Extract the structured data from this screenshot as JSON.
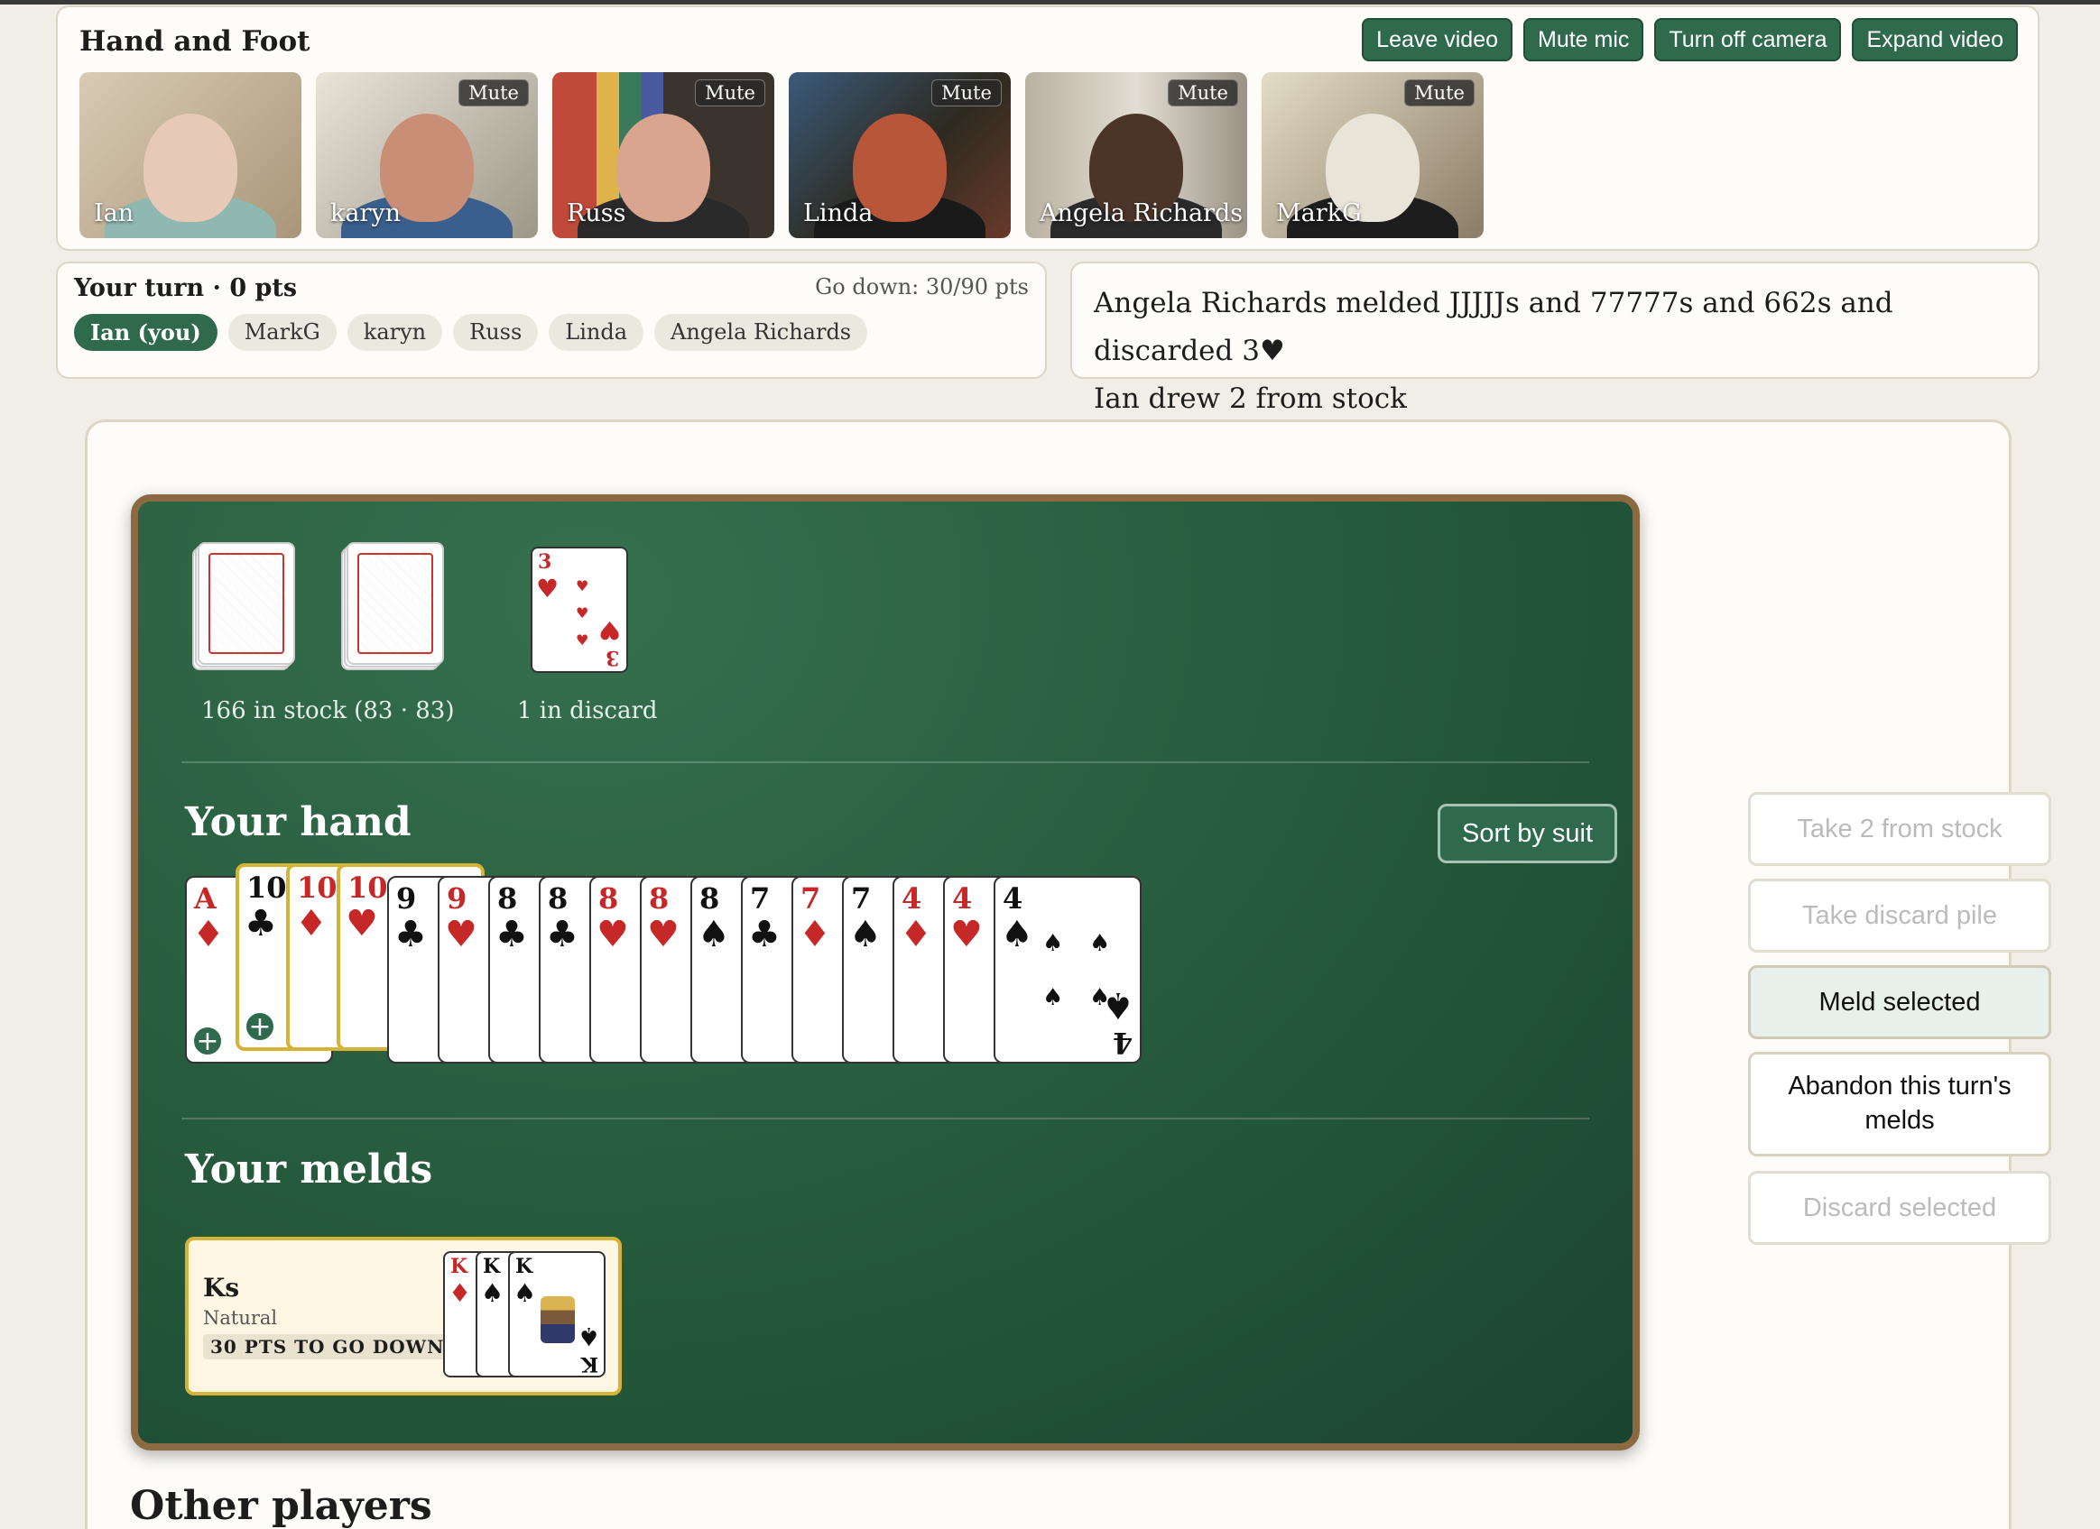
{
  "app": {
    "title": "Hand and Foot"
  },
  "video_controls": {
    "leave": "Leave video",
    "mute": "Mute mic",
    "camera": "Turn off camera",
    "expand": "Expand video"
  },
  "video_tiles": [
    {
      "name": "Ian",
      "mute": ""
    },
    {
      "name": "karyn",
      "mute": "Mute"
    },
    {
      "name": "Russ",
      "mute": "Mute"
    },
    {
      "name": "Linda",
      "mute": "Mute"
    },
    {
      "name": "Angela Richards",
      "mute": "Mute"
    },
    {
      "name": "MarkG",
      "mute": "Mute"
    }
  ],
  "status": {
    "turn": "Your turn · 0 pts",
    "go_down": "Go down: 30/90 pts"
  },
  "players": [
    "Ian (you)",
    "MarkG",
    "karyn",
    "Russ",
    "Linda",
    "Angela Richards"
  ],
  "log": [
    "Angela Richards melded JJJJJs and 77777s and 662s and discarded 3♥",
    "Ian drew 2 from stock"
  ],
  "piles": {
    "stock_label": "166 in stock (83 · 83)",
    "discard_label": "1 in discard",
    "discard_top": {
      "rank": "3",
      "suit": "♥"
    }
  },
  "hand": {
    "title": "Your hand",
    "sort_label": "Sort by suit",
    "cards": [
      {
        "rank": "A",
        "suit": "♦"
      },
      {
        "rank": "10",
        "suit": "♣"
      },
      {
        "rank": "10",
        "suit": "♦"
      },
      {
        "rank": "10",
        "suit": "♥"
      },
      {
        "rank": "9",
        "suit": "♣"
      },
      {
        "rank": "9",
        "suit": "♥"
      },
      {
        "rank": "8",
        "suit": "♣"
      },
      {
        "rank": "8",
        "suit": "♣"
      },
      {
        "rank": "8",
        "suit": "♥"
      },
      {
        "rank": "8",
        "suit": "♥"
      },
      {
        "rank": "8",
        "suit": "♠"
      },
      {
        "rank": "7",
        "suit": "♣"
      },
      {
        "rank": "7",
        "suit": "♦"
      },
      {
        "rank": "7",
        "suit": "♠"
      },
      {
        "rank": "4",
        "suit": "♦"
      },
      {
        "rank": "4",
        "suit": "♥"
      },
      {
        "rank": "4",
        "suit": "♠"
      }
    ],
    "plus": "+"
  },
  "melds": {
    "title": "Your melds",
    "items": [
      {
        "name": "Ks",
        "type": "Natural",
        "tag": "30 PTS TO GO DOWN",
        "cards": [
          {
            "rank": "K",
            "suit": "♦"
          },
          {
            "rank": "K",
            "suit": "♠"
          },
          {
            "rank": "K",
            "suit": "♠"
          }
        ]
      }
    ]
  },
  "actions": {
    "take_stock": "Take 2 from stock",
    "take_discard": "Take discard pile",
    "meld": "Meld selected",
    "abandon": "Abandon this turn's melds",
    "discard": "Discard selected"
  },
  "other_players_title": "Other players",
  "colors": {
    "felt": "#24573a",
    "accent": "#2f6a4d",
    "selected": "#d6b336",
    "red_suit": "#c62828"
  }
}
